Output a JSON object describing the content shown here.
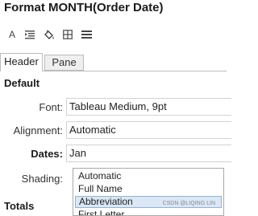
{
  "panel": {
    "title": "Format MONTH(Order Date)"
  },
  "toolbar": {
    "icons": [
      "font-icon",
      "alignment-icon",
      "shading-bucket-icon",
      "borders-icon",
      "lines-icon"
    ],
    "font_glyph": "A"
  },
  "tabs": [
    {
      "label": "Header",
      "active": true
    },
    {
      "label": "Pane",
      "active": false
    }
  ],
  "default_section": {
    "title": "Default",
    "font_label": "Font:",
    "font_value": "Tableau Medium, 9pt",
    "alignment_label": "Alignment:",
    "alignment_value": "Automatic"
  },
  "dates_row": {
    "label": "Dates:",
    "value": "Jan"
  },
  "shading": {
    "label": "Shading:"
  },
  "date_format_options": {
    "items": [
      "Automatic",
      "Full Name",
      "Abbreviation",
      "First Letter"
    ],
    "selected": "Abbreviation",
    "watermark": "CSDN @LIQING LIN"
  },
  "totals_section": {
    "title": "Totals"
  },
  "colors": {
    "selected_bg": "#dbe7f4",
    "selected_border": "#8fb3d9",
    "tab_border": "#bdbdbd"
  }
}
